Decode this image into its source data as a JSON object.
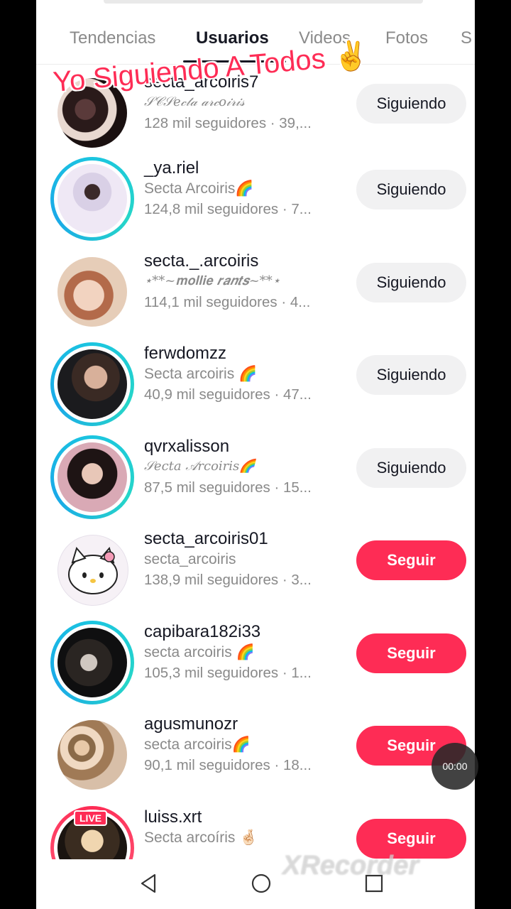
{
  "tabs": [
    {
      "label": "Tendencias",
      "active": false
    },
    {
      "label": "Usuarios",
      "active": true
    },
    {
      "label": "Videos",
      "active": false
    },
    {
      "label": "Fotos",
      "active": false
    },
    {
      "label": "S",
      "active": false
    }
  ],
  "overlay_caption": "Yo Siguiendo A Todos ✌️",
  "users": [
    {
      "username": "secta_arcoiris7",
      "nickname": "𝒮𝒞𝒮𝑒𝒸𝓉𝒶 𝒶𝓇𝒸𝑜𝒾𝓇𝒾𝓈",
      "meta": "128 mil seguidores · 39,...",
      "button": "Siguiendo"
    },
    {
      "username": "_ya.riel",
      "nickname": "Secta Arcoiris🌈",
      "meta": "124,8 mil seguidores · 7...",
      "button": "Siguiendo"
    },
    {
      "username": "secta._.arcoiris",
      "nickname": "⋆**~𝐦𝐨𝐥𝐥𝐢𝐞 𝒓𝒂𝒏𝒕𝒔~**⋆",
      "meta": "114,1 mil seguidores · 4...",
      "button": "Siguiendo"
    },
    {
      "username": "ferwdomzz",
      "nickname": "Secta arcoiris 🌈",
      "meta": "40,9 mil seguidores · 47...",
      "button": "Siguiendo"
    },
    {
      "username": "qvrxalisson",
      "nickname": "𝒮ecta 𝒜rcoiris🌈",
      "meta": "87,5 mil seguidores · 15...",
      "button": "Siguiendo"
    },
    {
      "username": "secta_arcoiris01",
      "nickname": "secta_arcoiris",
      "meta": "138,9 mil seguidores · 3...",
      "button": "Seguir"
    },
    {
      "username": "capibara182i33",
      "nickname": "secta arcoiris 🌈",
      "meta": "105,3 mil seguidores · 1...",
      "button": "Seguir"
    },
    {
      "username": "agusmunozr",
      "nickname": "secta arcoiris🌈",
      "meta": "90,1 mil seguidores · 18...",
      "button": "Seguir"
    },
    {
      "username": "luiss.xrt",
      "nickname": "Secta arcoíris 🤞🏻",
      "meta": "",
      "button": "Seguir",
      "live_label": "LIVE"
    }
  ],
  "recorder_timer": "00:00",
  "watermark": "XRecorder",
  "colors": {
    "accent": "#fe2c55",
    "story_ring": "#1bc5e0",
    "following_bg": "#f1f1f2"
  }
}
